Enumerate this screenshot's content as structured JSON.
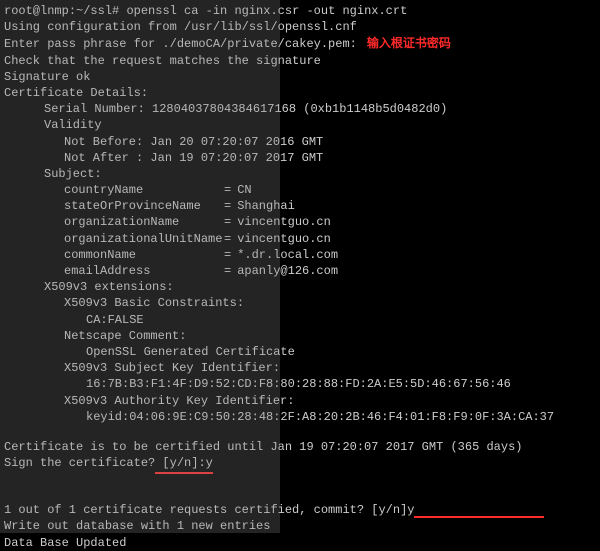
{
  "prompt": {
    "user": "root@lnmp",
    "path": "~/ssl",
    "cmd": "openssl ca -in nginx.csr -out nginx.crt"
  },
  "lines": {
    "cfg": "Using configuration from /usr/lib/ssl/openssl.cnf",
    "pass": "Enter pass phrase for ./demoCA/private/cakey.pem:",
    "annot": "输入根证书密码",
    "check": "Check that the request matches the signature",
    "sigok": "Signature ok",
    "certdet": "Certificate Details:",
    "serial": "Serial Number: 12804037804384617168 (0xb1b1148b5d0482d0)",
    "validity": "Validity",
    "nb": "Not Before: Jan 20 07:20:07 2016 GMT",
    "na": "Not After : Jan 19 07:20:07 2017 GMT",
    "subject": "Subject:",
    "ext": "X509v3 extensions:",
    "bc": "X509v3 Basic Constraints:",
    "bc_v": "CA:FALSE",
    "nc": "Netscape Comment:",
    "nc_v": "OpenSSL Generated Certificate",
    "ski": "X509v3 Subject Key Identifier:",
    "ski_v": "16:7B:B3:F1:4F:D9:52:CD:F8:80:28:88:FD:2A:E5:5D:46:67:56:46",
    "aki": "X509v3 Authority Key Identifier:",
    "aki_v": "keyid:04:06:9E:C9:50:28:48:2F:A8:20:2B:46:F4:01:F8:F9:0F:3A:CA:37",
    "certuntil": "Certificate is to be certified until Jan 19 07:20:07 2017 GMT (365 days)",
    "sign_q": "Sign the certificate?",
    "sign_in": " [y/n]:y",
    "commit": "1 out of 1 certificate requests certified, commit? [y/n]y",
    "writeout": "Write out database with 1 new entries",
    "updated": "Data Base Updated"
  },
  "subject": {
    "countryName": "CN",
    "stateOrProvinceName": "Shanghai",
    "organizationName": "vincentguo.cn",
    "organizationalUnitName": "vincentguo.cn",
    "commonName": "*.dr.local.com",
    "emailAddress": "apanly@126.com"
  }
}
